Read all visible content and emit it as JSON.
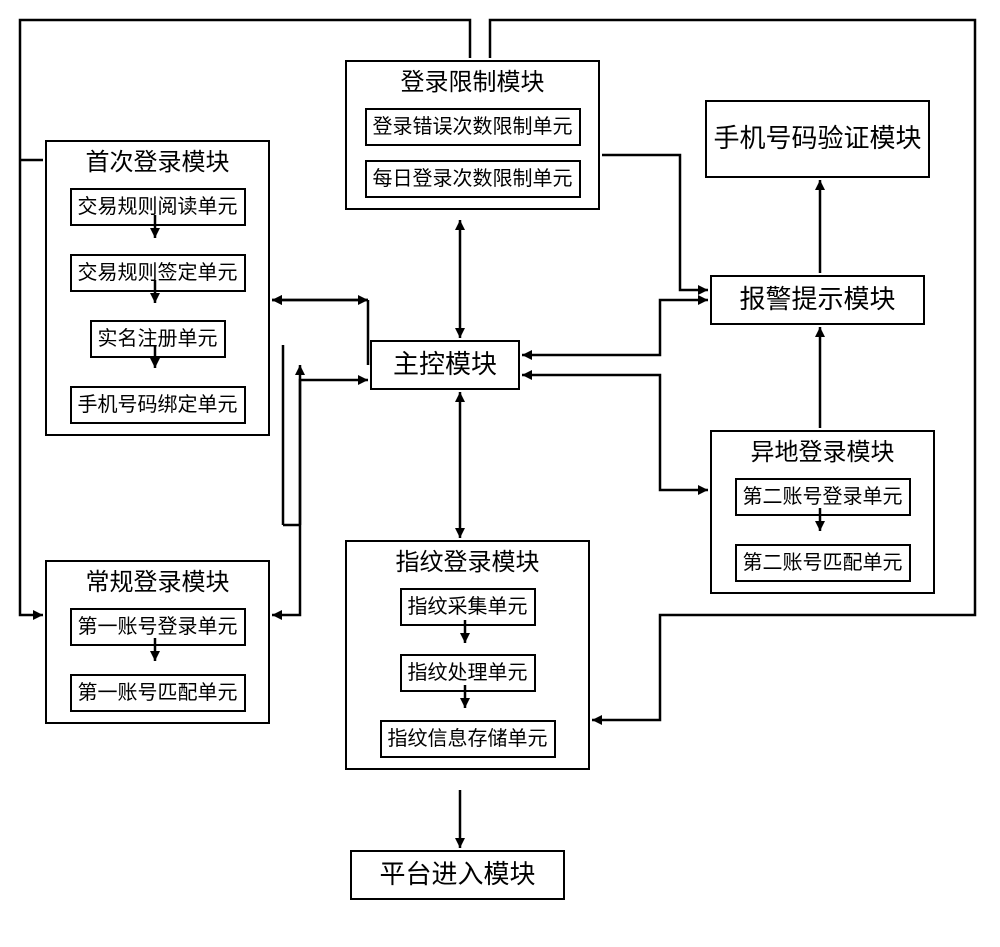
{
  "chart_data": {
    "type": "diagram",
    "title": "",
    "nodes": [
      {
        "id": "main",
        "label": "主控模块",
        "units": []
      },
      {
        "id": "login_limit",
        "label": "登录限制模块",
        "units": [
          "登录错误次数限制单元",
          "每日登录次数限制单元"
        ]
      },
      {
        "id": "first_login",
        "label": "首次登录模块",
        "units": [
          "交易规则阅读单元",
          "交易规则签定单元",
          "实名注册单元",
          "手机号码绑定单元"
        ]
      },
      {
        "id": "normal_login",
        "label": "常规登录模块",
        "units": [
          "第一账号登录单元",
          "第一账号匹配单元"
        ]
      },
      {
        "id": "fingerprint",
        "label": "指纹登录模块",
        "units": [
          "指纹采集单元",
          "指纹处理单元",
          "指纹信息存储单元"
        ]
      },
      {
        "id": "remote_login",
        "label": "异地登录模块",
        "units": [
          "第二账号登录单元",
          "第二账号匹配单元"
        ]
      },
      {
        "id": "alarm",
        "label": "报警提示模块",
        "units": []
      },
      {
        "id": "phone_verify",
        "label": "手机号码验证模块",
        "units": []
      },
      {
        "id": "platform_enter",
        "label": "平台进入模块",
        "units": []
      }
    ],
    "edges": [
      [
        "main",
        "login_limit",
        "bi"
      ],
      [
        "main",
        "first_login",
        "bi"
      ],
      [
        "main",
        "normal_login",
        "bi"
      ],
      [
        "main",
        "fingerprint",
        "bi"
      ],
      [
        "main",
        "remote_login",
        "bi"
      ],
      [
        "main",
        "alarm",
        "bi"
      ],
      [
        "login_limit",
        "alarm",
        "uni"
      ],
      [
        "remote_login",
        "alarm",
        "uni"
      ],
      [
        "alarm",
        "phone_verify",
        "uni"
      ],
      [
        "fingerprint",
        "platform_enter",
        "uni"
      ],
      [
        "first_login.0",
        "first_login.1",
        "uni"
      ],
      [
        "first_login.1",
        "first_login.2",
        "uni"
      ],
      [
        "first_login.2",
        "first_login.3",
        "uni"
      ],
      [
        "normal_login.0",
        "normal_login.1",
        "uni"
      ],
      [
        "fingerprint.0",
        "fingerprint.1",
        "uni"
      ],
      [
        "fingerprint.1",
        "fingerprint.2",
        "uni"
      ],
      [
        "remote_login.0",
        "remote_login.1",
        "uni"
      ]
    ]
  },
  "main": {
    "title": "主控模块"
  },
  "login_limit": {
    "title": "登录限制模块",
    "u0": "登录错误次数限制单元",
    "u1": "每日登录次数限制单元"
  },
  "first_login": {
    "title": "首次登录模块",
    "u0": "交易规则阅读单元",
    "u1": "交易规则签定单元",
    "u2": "实名注册单元",
    "u3": "手机号码绑定单元"
  },
  "normal_login": {
    "title": "常规登录模块",
    "u0": "第一账号登录单元",
    "u1": "第一账号匹配单元"
  },
  "fingerprint": {
    "title": "指纹登录模块",
    "u0": "指纹采集单元",
    "u1": "指纹处理单元",
    "u2": "指纹信息存储单元"
  },
  "remote_login": {
    "title": "异地登录模块",
    "u0": "第二账号登录单元",
    "u1": "第二账号匹配单元"
  },
  "alarm": {
    "title": "报警提示模块"
  },
  "phone_verify": {
    "title": "手机号码验证模块"
  },
  "platform_enter": {
    "title": "平台进入模块"
  }
}
